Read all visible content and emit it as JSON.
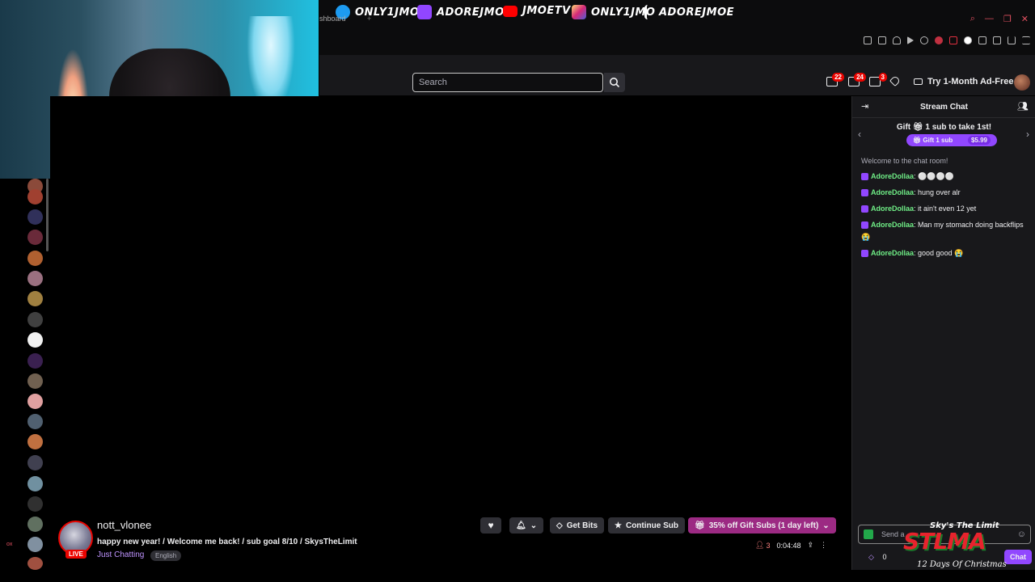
{
  "socials": [
    {
      "icon": "twitter-icon",
      "color": "#1d9bf0",
      "handle": "ONLY1JMOE"
    },
    {
      "icon": "twitch-icon",
      "color": "#9146ff",
      "handle": "ADOREJMOE"
    },
    {
      "icon": "youtube-icon",
      "color": "#ff0000",
      "handle": "JMOETV"
    },
    {
      "icon": "instagram-icon",
      "color": "#e1306c",
      "handle": "ONLY1JMO"
    },
    {
      "icon": "tiktok-icon",
      "color": "#ffffff",
      "handle": "ADOREJMOE"
    }
  ],
  "browser": {
    "tab_label": "shboard",
    "tab_add": "+"
  },
  "topnav": {
    "search_placeholder": "Search",
    "inbox_count": "22",
    "messages_count": "24",
    "alerts_count": "3",
    "ad_free_label": "Try 1-Month Ad-Free"
  },
  "channel": {
    "name": "nott_vlonee",
    "live_label": "LIVE",
    "title": "happy new year! / Welcome me back! / sub goal 8/10 / SkysTheLimit",
    "category": "Just Chatting",
    "language": "English",
    "viewers": "3",
    "uptime": "0:04:48"
  },
  "actions": {
    "get_bits": "Get Bits",
    "continue_sub": "Continue Sub",
    "gift_subs": "35% off Gift Subs (1 day left)"
  },
  "chat": {
    "title": "Stream Chat",
    "gift_promo_pre": "Gift",
    "gift_promo_post": "1 sub to take 1st!",
    "gift_btn": "Gift 1 sub",
    "gift_price": "$5.99",
    "welcome": "Welcome to the chat room!",
    "messages": [
      {
        "user": "AdoreDollaa",
        "text": "⚪⚪⚪⚪"
      },
      {
        "user": "AdoreDollaa",
        "text": "hung over alr"
      },
      {
        "user": "AdoreDollaa",
        "text": "it ain't even 12 yet"
      },
      {
        "user": "AdoreDollaa",
        "text": "Man my stomach doing backflips 😭"
      },
      {
        "user": "AdoreDollaa",
        "text": "good good 😭"
      }
    ],
    "input_placeholder": "Send a",
    "points": "0",
    "send_label": "Chat"
  },
  "overlay": {
    "sky_top": "Sky's The Limit",
    "sky_main": "STLMA",
    "sky_bottom": "12 Days Of Christmas"
  },
  "sidebar_label": "ox"
}
